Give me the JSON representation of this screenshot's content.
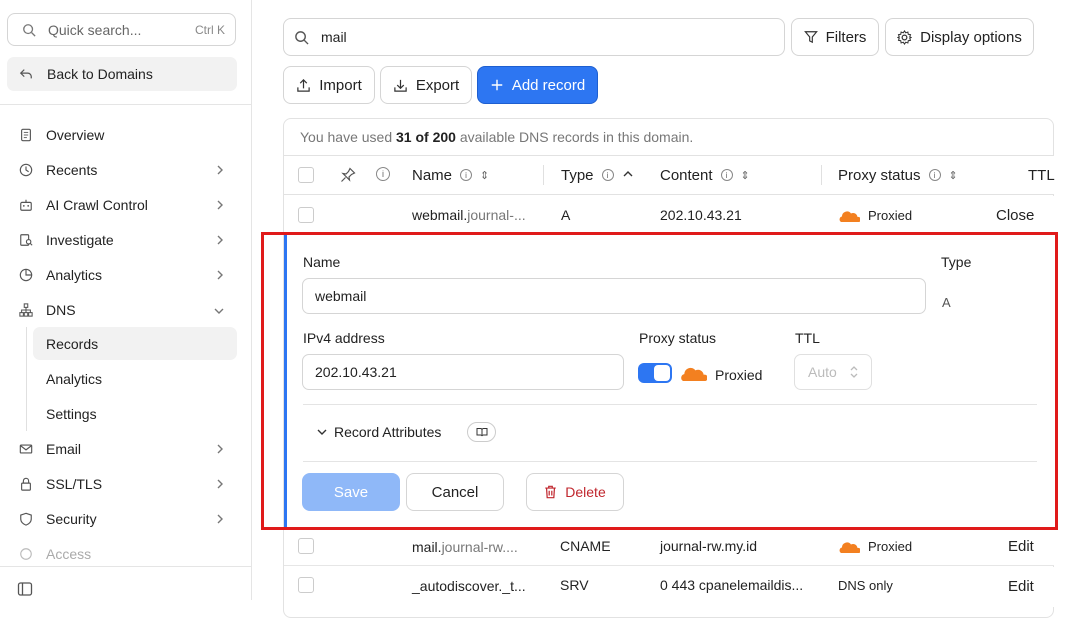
{
  "sidebar": {
    "quick_search_placeholder": "Quick search...",
    "quick_search_shortcut": "Ctrl K",
    "back_label": "Back to Domains",
    "items": [
      {
        "label": "Overview",
        "icon": "document-icon"
      },
      {
        "label": "Recents",
        "icon": "clock-icon"
      },
      {
        "label": "AI Crawl Control",
        "icon": "robot-icon"
      },
      {
        "label": "Investigate",
        "icon": "investigate-icon"
      },
      {
        "label": "Analytics",
        "icon": "pie-chart-icon"
      },
      {
        "label": "DNS",
        "icon": "network-icon"
      },
      {
        "label": "Email",
        "icon": "email-icon"
      },
      {
        "label": "SSL/TLS",
        "icon": "lock-icon"
      },
      {
        "label": "Security",
        "icon": "shield-icon"
      },
      {
        "label": "Access",
        "icon": "access-icon"
      }
    ],
    "dns_sub": [
      "Records",
      "Analytics",
      "Settings"
    ]
  },
  "toolbar": {
    "search_value": "mail",
    "filters_label": "Filters",
    "display_options_label": "Display options",
    "import_label": "Import",
    "export_label": "Export",
    "add_record_label": "Add record"
  },
  "usage": {
    "prefix": "You have used ",
    "count": "31 of 200",
    "suffix": " available DNS records in this domain."
  },
  "table": {
    "headers": {
      "name": "Name",
      "type": "Type",
      "content": "Content",
      "proxy": "Proxy status",
      "ttl": "TTL"
    },
    "rows": [
      {
        "name_main": "webmail.",
        "name_rest": "journal-...",
        "type": "A",
        "content": "202.10.43.21",
        "proxy": "Proxied",
        "action": "Close"
      },
      {
        "name_main": "mail.",
        "name_rest": "journal-rw....",
        "type": "CNAME",
        "content": "journal-rw.my.id",
        "proxy": "Proxied",
        "action": "Edit"
      },
      {
        "name_main": "_autodiscover._t...",
        "name_rest": "",
        "type": "SRV",
        "content": "0 443 cpanelemaildis...",
        "proxy": "DNS only",
        "action": "Edit"
      }
    ]
  },
  "edit_form": {
    "name_label": "Name",
    "name_value": "webmail",
    "type_label": "Type",
    "type_value": "A",
    "ipv4_label": "IPv4 address",
    "ipv4_value": "202.10.43.21",
    "proxy_label": "Proxy status",
    "proxy_value": "Proxied",
    "ttl_label": "TTL",
    "ttl_value": "Auto",
    "record_attributes_label": "Record Attributes",
    "save_label": "Save",
    "cancel_label": "Cancel",
    "delete_label": "Delete"
  },
  "colors": {
    "accent": "#2d76f2",
    "cloud": "#f38020",
    "danger": "#c0262d",
    "highlight": "#e01a1a"
  }
}
